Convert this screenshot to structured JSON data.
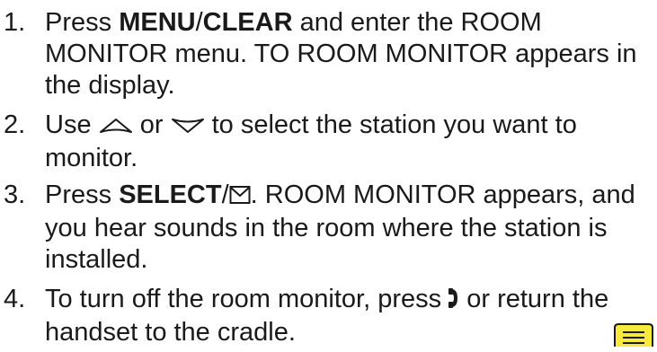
{
  "steps": [
    {
      "number": "1.",
      "lines": {
        "l1a": "Press ",
        "l1b": "MENU",
        "l1c": "/",
        "l1d": "CLEAR",
        "l1e": " and enter the ROOM",
        "l2": "MONITOR menu. TO ROOM MONITOR appears in",
        "l3": "the display."
      }
    },
    {
      "number": "2.",
      "lines": {
        "l1a": "Use ",
        "l1b": " or ",
        "l1c": " to select the station you want to",
        "l2": "monitor."
      },
      "icons": [
        "up-arrow-icon",
        "down-arrow-icon"
      ]
    },
    {
      "number": "3.",
      "lines": {
        "l1a": "Press ",
        "l1b": "SELECT",
        "l1c": "/",
        "l1d": ". ROOM MONITOR appears, and",
        "l2": "you hear sounds in the room where the station is",
        "l3": "installed."
      },
      "icons": [
        "envelope-icon"
      ]
    },
    {
      "number": "4.",
      "lines": {
        "l1a": "To turn off the room monitor, press ",
        "l1b": " or return the",
        "l2": "handset to the cradle."
      },
      "icons": [
        "phone-handset-icon"
      ]
    }
  ],
  "note_icon": {
    "name": "note-icon",
    "color": "#f7ea3d"
  }
}
